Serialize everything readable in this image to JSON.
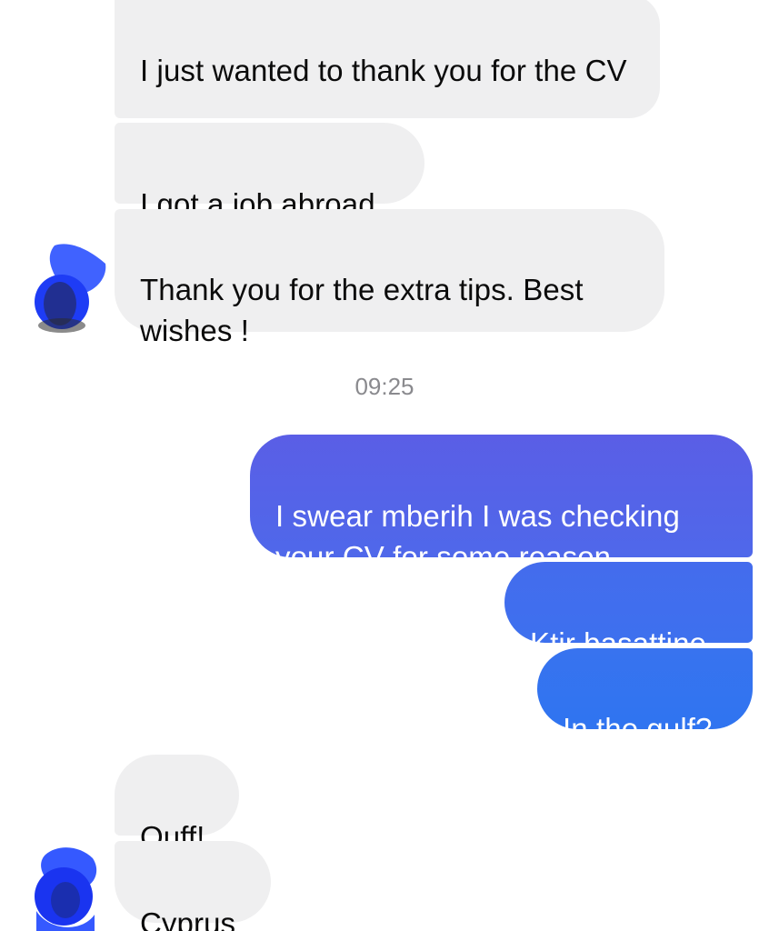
{
  "conversation": {
    "received_group_1": [
      "I just wanted to thank you for the CV",
      "I got a job abroad",
      "Thank you for the extra tips. Best wishes !"
    ],
    "timestamp": "09:25",
    "sent_group": [
      "I swear mberih I was checking your CV for some reason",
      "Ktir basattine",
      "In the gulf?"
    ],
    "received_group_2": [
      "Ouff!",
      "Cyprus"
    ]
  },
  "colors": {
    "incoming_bubble": "#efeff0",
    "incoming_text": "#0b0b0b",
    "outgoing_gradient_top": "#5a5ee6",
    "outgoing_gradient_bottom": "#2f74f0",
    "outgoing_text": "#ffffff",
    "timestamp_text": "#8a8a8e",
    "avatar_redaction": "#1f47ff"
  },
  "icons": {
    "contact_avatar": "redacted-avatar-icon"
  }
}
